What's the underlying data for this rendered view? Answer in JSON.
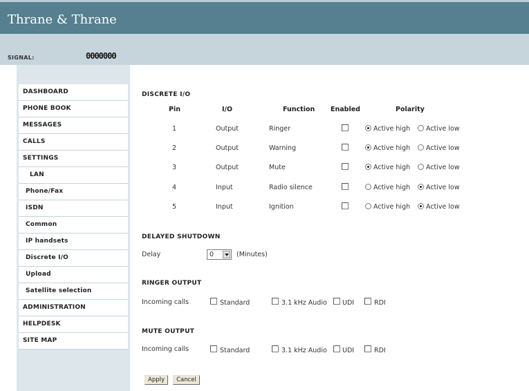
{
  "brand": {
    "logo_text": "Thrane & Thrane"
  },
  "signal": {
    "label": "SIGNAL:",
    "bars": "0000000"
  },
  "sidebar": {
    "items": [
      {
        "label": "DASHBOARD"
      },
      {
        "label": "PHONE BOOK"
      },
      {
        "label": "MESSAGES"
      },
      {
        "label": "CALLS"
      },
      {
        "label": "SETTINGS"
      },
      {
        "label": "LAN"
      },
      {
        "label": "Phone/Fax"
      },
      {
        "label": "ISDN"
      },
      {
        "label": "Common"
      },
      {
        "label": "IP handsets"
      },
      {
        "label": "Discrete I/O"
      },
      {
        "label": "Upload"
      },
      {
        "label": "Satellite selection"
      },
      {
        "label": "ADMINISTRATION"
      },
      {
        "label": "HELPDESK"
      },
      {
        "label": "SITE MAP"
      }
    ]
  },
  "discrete_io": {
    "title": "DISCRETE I/O",
    "columns": [
      "Pin",
      "I/O",
      "Function",
      "Enabled",
      "Polarity"
    ],
    "polarity_high": "Active high",
    "polarity_low": "Active low",
    "rows": [
      {
        "pin": "1",
        "io": "Output",
        "function": "Ringer",
        "enabled": false,
        "polarity": "high"
      },
      {
        "pin": "2",
        "io": "Output",
        "function": "Warning",
        "enabled": false,
        "polarity": "high"
      },
      {
        "pin": "3",
        "io": "Output",
        "function": "Mute",
        "enabled": false,
        "polarity": "high"
      },
      {
        "pin": "4",
        "io": "Input",
        "function": "Radio silence",
        "enabled": false,
        "polarity": "low"
      },
      {
        "pin": "5",
        "io": "Input",
        "function": "Ignition",
        "enabled": false,
        "polarity": "low"
      }
    ]
  },
  "delayed_shutdown": {
    "title": "DELAYED SHUTDOWN",
    "delay_label": "Delay",
    "delay_value": "0",
    "unit": "(Minutes)"
  },
  "ringer_output": {
    "title": "RINGER OUTPUT",
    "label": "Incoming calls",
    "options": [
      "Standard",
      "3.1 kHz Audio",
      "UDI",
      "RDI"
    ]
  },
  "mute_output": {
    "title": "MUTE OUTPUT",
    "label": "Incoming calls",
    "options": [
      "Standard",
      "3.1 kHz Audio",
      "UDI",
      "RDI"
    ]
  },
  "actions": {
    "apply": "Apply",
    "cancel": "Cancel"
  }
}
